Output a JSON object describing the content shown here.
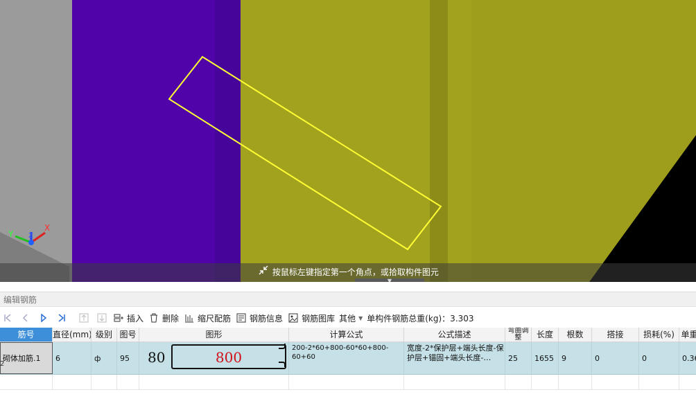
{
  "viewport": {
    "hint": "按鼠标左键指定第一个角点，或拾取构件图元",
    "axis_labels": {
      "x": "X",
      "y": "Y",
      "z": "Z"
    },
    "colors": {
      "grey_wall": "#9b9b9b",
      "purple_wall": "#4f03a8",
      "olive_wall": "#a3a21f",
      "olive_dark": "#8d8c18",
      "selection": "#ffff33",
      "black": "#000000"
    }
  },
  "panel": {
    "title": "编辑钢筋",
    "toolbar": {
      "nav_icons": [
        "first-page-icon",
        "prev-page-icon",
        "next-page-icon",
        "last-page-icon",
        "move-up-icon",
        "move-down-icon"
      ],
      "insert": "插入",
      "delete": "删除",
      "scale_rebar": "缩尺配筋",
      "rebar_info": "钢筋信息",
      "rebar_library": "钢筋图库",
      "other": "其他",
      "total_weight": "单构件钢筋总重(kg)：3.303"
    },
    "columns": [
      "筋号",
      "直径(mm)",
      "级别",
      "图号",
      "图形",
      "计算公式",
      "公式描述",
      "弯曲调整",
      "长度",
      "根数",
      "搭接",
      "损耗(%)",
      "单重"
    ],
    "rows": [
      {
        "id": "砌体加筋.1",
        "diameter": "6",
        "grade": "ф",
        "fig": "95",
        "shape_left": "80",
        "shape_main": "800",
        "formula": "200-2*60+800-60*60+800-60+60",
        "desc": "宽度-2*保护层+端头长度-保护层+锚固+端头长度-…",
        "bend": "25",
        "length": "1655",
        "count": "9",
        "lap": "0",
        "loss": "0",
        "unit": "0.36"
      }
    ],
    "empty_row_num": "2"
  }
}
